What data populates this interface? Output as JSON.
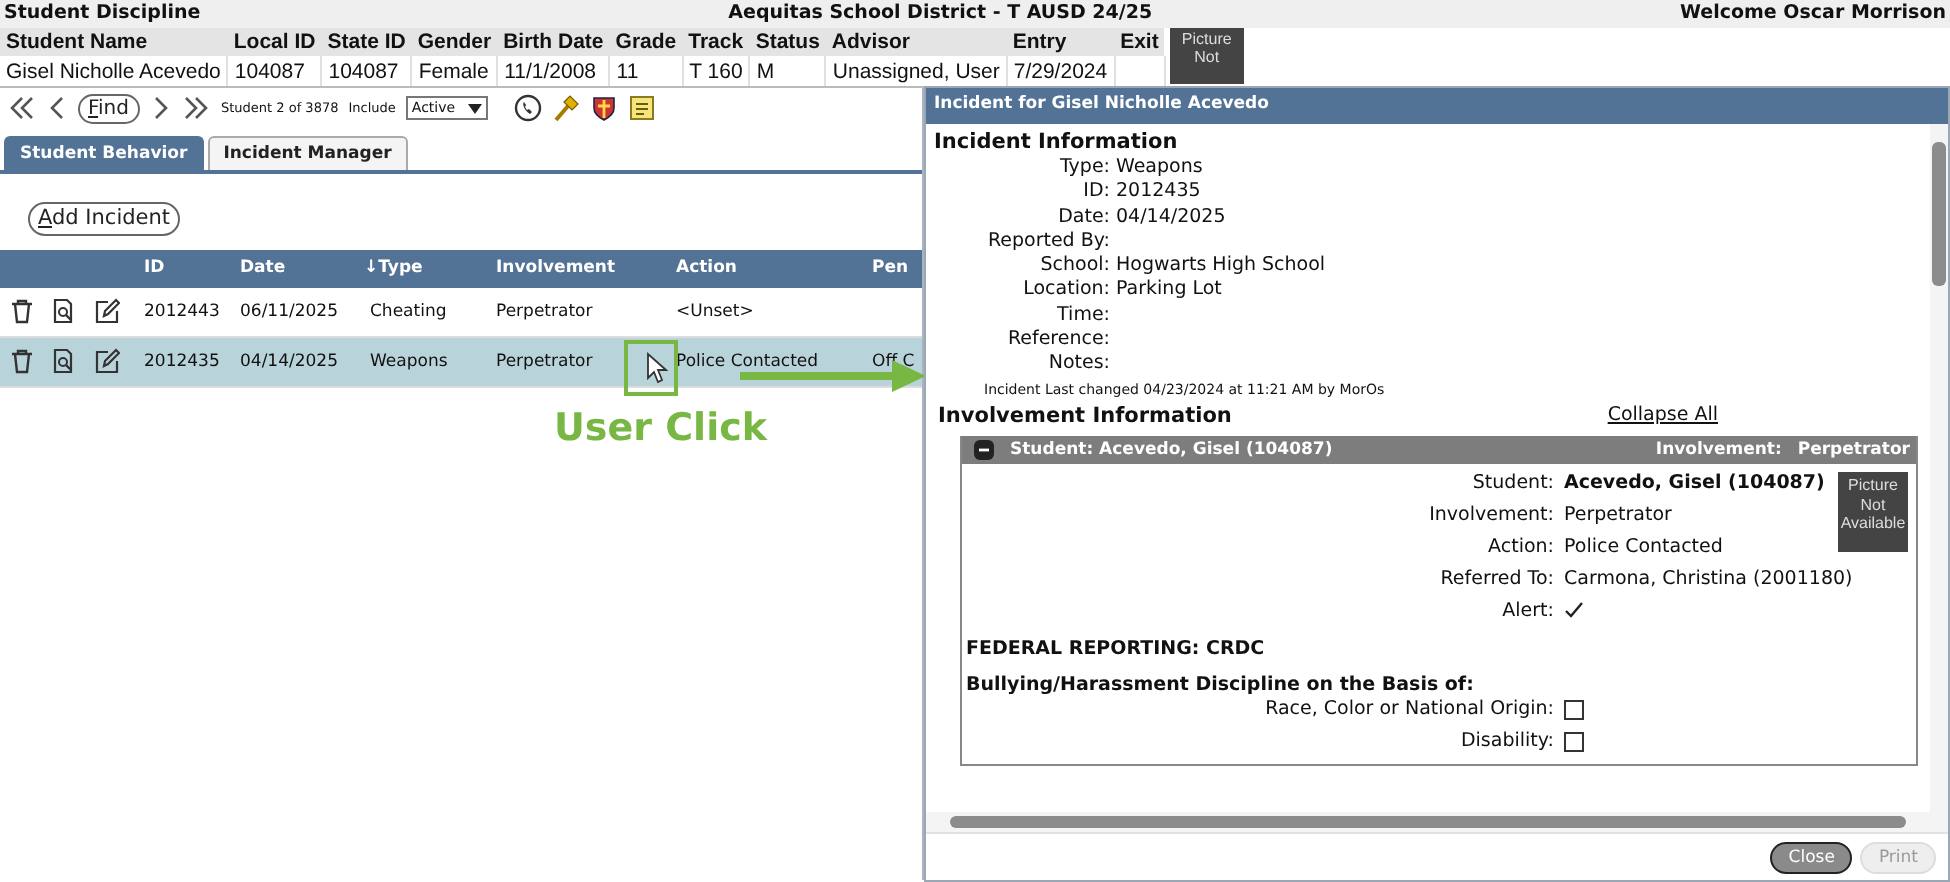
{
  "app_title": "Student Discipline",
  "district": "Aequitas School District - T AUSD 24/25",
  "welcome": "Welcome Oscar Morrison",
  "student": {
    "columns": [
      "Student Name",
      "Local ID",
      "State ID",
      "Gender",
      "Birth Date",
      "Grade",
      "Track",
      "Status",
      "Advisor",
      "Entry",
      "Exit"
    ],
    "values": [
      "Gisel Nicholle Acevedo",
      "104087",
      "104087",
      "Female",
      "11/1/2008",
      "11",
      "T 160",
      "M",
      "Unassigned, User",
      "7/29/2024"
    ],
    "photo": "Picture Not"
  },
  "toolbar": {
    "find": "Find",
    "position": "Student 2 of 3878",
    "include_label": "Include",
    "include_value": "Active"
  },
  "tabs": [
    {
      "label": "Student Behavior",
      "selected": true
    },
    {
      "label": "Incident Manager",
      "selected": false
    }
  ],
  "add_button": "Add Incident",
  "incidents": {
    "columns": [
      {
        "label": "ID"
      },
      {
        "label": "Date"
      },
      {
        "label": "Type",
        "sort_mark": "↓"
      },
      {
        "label": "Involvement"
      },
      {
        "label": "Action"
      },
      {
        "label": "Pen"
      }
    ],
    "rows": [
      {
        "id": "2012443",
        "date": "06/11/2025",
        "type": "Cheating",
        "involvement": "Perpetrator",
        "action": "<Unset>",
        "selected": false
      },
      {
        "id": "2012435",
        "date": "04/14/2025",
        "type": "Weapons",
        "involvement": "Perpetrator",
        "action": "Police Contacted",
        "penalty": "Off C",
        "selected": true
      }
    ]
  },
  "annotation": {
    "label": "User Click"
  },
  "dialog": {
    "title": "Incident for Gisel Nicholle Acevedo",
    "incident_heading": "Incident Information",
    "fields": [
      {
        "label": "Type:",
        "value": "Weapons"
      },
      {
        "label": "ID:",
        "value": "2012435"
      },
      {
        "label": "Date:",
        "value": "04/14/2025"
      },
      {
        "label": "Reported By:"
      },
      {
        "label": "School:",
        "value": "Hogwarts High School"
      },
      {
        "label": "Location:",
        "value": "Parking Lot"
      },
      {
        "label": "Time:"
      },
      {
        "label": "Reference:"
      },
      {
        "label": "Notes:"
      }
    ],
    "last_changed": "Incident Last changed 04/23/2024 at 11:21 AM by MorOs",
    "involvement_heading": "Involvement Information",
    "collapse_link": "Collapse All",
    "involvement": {
      "expanded": true,
      "header": "Student: Acevedo, Gisel (104087)",
      "involvement_label": "Involvement:",
      "involvement_value": "Perpetrator",
      "photo": "Picture Not Available",
      "fields": [
        {
          "label": "Student:",
          "value": "Acevedo, Gisel (104087)",
          "kind": "bold"
        },
        {
          "label": "Involvement:",
          "value": "Perpetrator",
          "kind": "text"
        },
        {
          "label": "Action:",
          "value": "Police Contacted",
          "kind": "text"
        },
        {
          "label": "Referred To:",
          "value": "Carmona, Christina (2001180)",
          "kind": "text"
        },
        {
          "label": "Alert:",
          "kind": "check",
          "checked": true
        }
      ],
      "federal_heading": "FEDERAL REPORTING: CRDC",
      "basis_heading": "Bullying/Harassment Discipline on the Basis of:",
      "basis": [
        {
          "label": "Race, Color or National Origin:",
          "checked": false
        },
        {
          "label": "Disability:",
          "checked": false
        }
      ]
    },
    "buttons": [
      {
        "label": "Close",
        "disabled": false
      },
      {
        "label": "Print",
        "disabled": true
      }
    ]
  }
}
